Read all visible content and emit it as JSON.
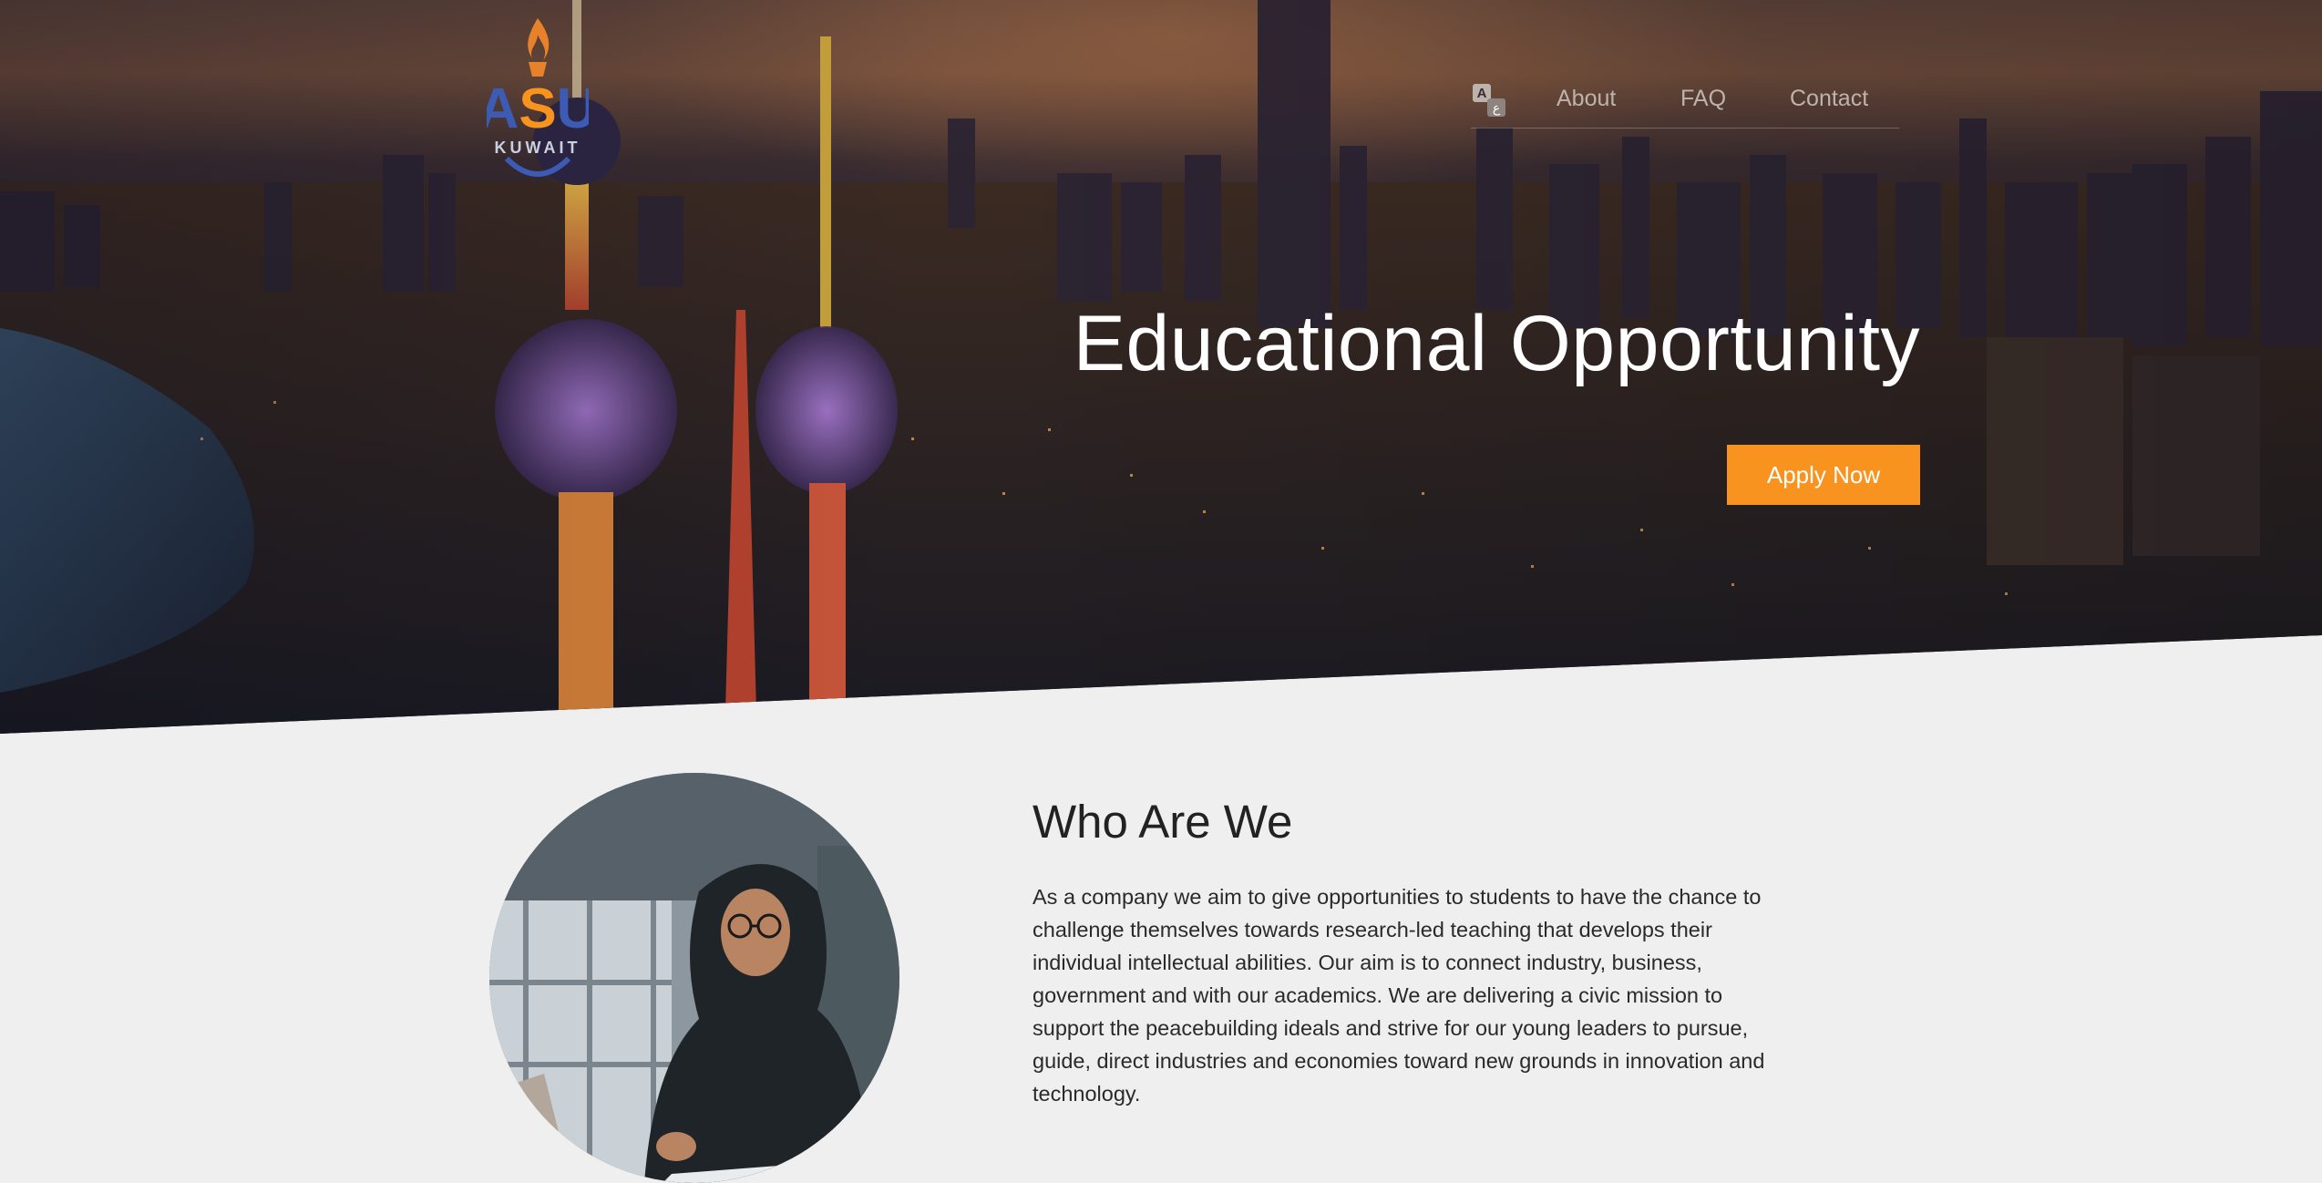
{
  "brand": {
    "logo_text": "ASU",
    "logo_subtext": "KUWAIT",
    "colors": {
      "accent": "#f7931e",
      "logo_blue": "#3b5bb5"
    }
  },
  "nav": {
    "language_icon": "translate-icon",
    "items": [
      {
        "label": "About"
      },
      {
        "label": "FAQ"
      },
      {
        "label": "Contact"
      }
    ]
  },
  "hero": {
    "title": "Educational Opportunity",
    "cta_label": "Apply Now"
  },
  "about": {
    "title": "Who Are We",
    "body": "As a company we aim to give opportunities to students to have the chance to challenge themselves towards research-led teaching that develops their individual intellectual abilities. Our aim is to connect industry, business, government and with our academics. We are delivering a civic mission to support the peacebuilding ideals and strive for our young leaders to pursue, guide, direct industries and economies toward new grounds in innovation and technology."
  }
}
